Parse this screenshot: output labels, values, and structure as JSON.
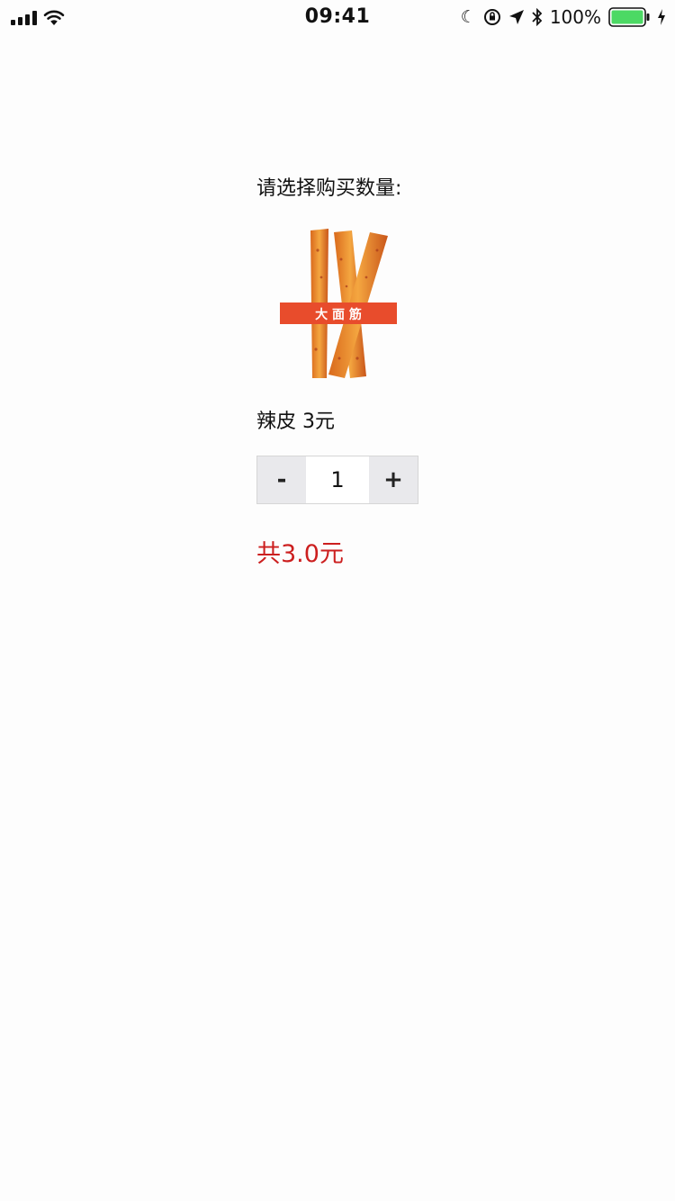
{
  "status_bar": {
    "time": "09:41",
    "battery_percent": "100%",
    "icons": [
      "signal-icon",
      "wifi-icon",
      "moon-icon",
      "orientation-lock-icon",
      "location-icon",
      "bluetooth-icon",
      "battery-icon",
      "charging-icon"
    ],
    "battery_color": "#4cd964"
  },
  "main": {
    "prompt": "请选择购买数量:",
    "product": {
      "name_label": "辣皮 3元",
      "image_banner_text": "大 面 筋",
      "image_banner_color": "#e84c2c"
    },
    "stepper": {
      "decrement_label": "-",
      "value": "1",
      "increment_label": "+"
    },
    "total": "共3.0元",
    "total_color": "#cc1f1f"
  }
}
